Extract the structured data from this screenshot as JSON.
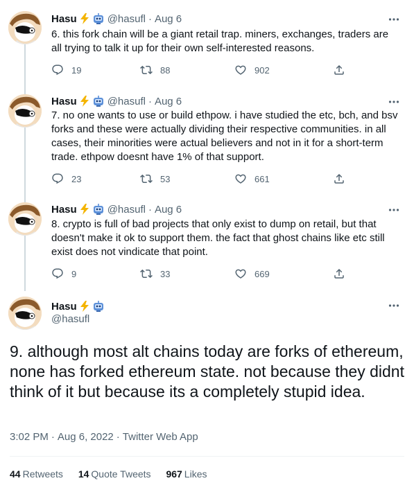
{
  "tweets": [
    {
      "name": "Hasu",
      "handle": "@hasufl",
      "sep": "·",
      "date": "Aug 6",
      "text": "6. this fork chain will be a giant retail trap. miners, exchanges, traders are all trying to talk it up for their own self-interested reasons.",
      "replies": "19",
      "retweets": "88",
      "likes": "902"
    },
    {
      "name": "Hasu",
      "handle": "@hasufl",
      "sep": "·",
      "date": "Aug 6",
      "text": "7. no one wants to use or build ethpow. i have studied the etc, bch, and bsv forks and these were actually dividing their respective communities. in all cases, their minorities were actual believers and not in it for a short-term trade. ethpow doesnt have 1% of that support.",
      "replies": "23",
      "retweets": "53",
      "likes": "661"
    },
    {
      "name": "Hasu",
      "handle": "@hasufl",
      "sep": "·",
      "date": "Aug 6",
      "text": "8. crypto is full of bad projects that only exist to dump on retail, but that doesn't make it ok to support them. the fact that ghost chains like etc still exist does not vindicate that point.",
      "replies": "9",
      "retweets": "33",
      "likes": "669"
    }
  ],
  "focal": {
    "name": "Hasu",
    "handle": "@hasufl",
    "text": "9. although most alt chains today are forks of ethereum, none has forked ethereum state. not because they didnt think of it but because its a completely stupid idea.",
    "time": "3:02 PM",
    "sep": "·",
    "date": "Aug 6, 2022",
    "source": "Twitter Web App",
    "retweets_count": "44",
    "retweets_label": "Retweets",
    "quotes_count": "14",
    "quotes_label": "Quote Tweets",
    "likes_count": "967",
    "likes_label": "Likes"
  },
  "icons": {
    "reply": "reply-icon",
    "retweet": "retweet-icon",
    "like": "like-icon",
    "share": "share-icon",
    "more": "more-icon",
    "lightning": "lightning-emoji-icon",
    "robot": "robot-emoji-icon"
  },
  "colors": {
    "text": "#0f1419",
    "secondary": "#536471",
    "thread_line": "#cfd9de",
    "lightning": "#f4b400",
    "robot": "#5b8fd8"
  }
}
